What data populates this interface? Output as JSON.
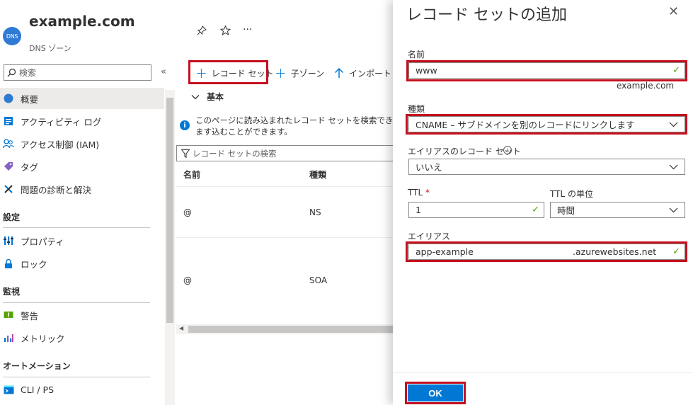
{
  "resource": {
    "badge": "DNS",
    "title": "example.com",
    "subtitle": "DNS ゾーン",
    "more": "···"
  },
  "search": {
    "placeholder": "検索",
    "collapse": "«"
  },
  "nav": {
    "items": [
      {
        "label": "概要",
        "icon": "dns-zone-icon"
      },
      {
        "label": "アクティビティ ログ",
        "icon": "activity-log-icon"
      },
      {
        "label": "アクセス制御 (IAM)",
        "icon": "iam-icon"
      },
      {
        "label": "タグ",
        "icon": "tag-icon"
      },
      {
        "label": "問題の診断と解決",
        "icon": "wrench-icon"
      },
      {
        "label": "プロパティ",
        "icon": "properties-icon"
      },
      {
        "label": "ロック",
        "icon": "lock-icon"
      },
      {
        "label": "警告",
        "icon": "alert-icon"
      },
      {
        "label": "メトリック",
        "icon": "metrics-icon"
      },
      {
        "label": "CLI / PS",
        "icon": "cli-icon"
      }
    ],
    "sections": [
      "設定",
      "監視",
      "オートメーション"
    ]
  },
  "commands": {
    "add_recordset": "レコード セット",
    "child_zone": "子ゾーン",
    "import": "インポート"
  },
  "essentials": "基本",
  "info_text": "このページに読み込まれたレコード セットを検索できます込むことができます。",
  "filter": {
    "placeholder": "レコード セットの検索"
  },
  "table": {
    "headers": [
      "名前",
      "種類"
    ],
    "rows": [
      {
        "name": "@",
        "type": "NS"
      },
      {
        "name": "@",
        "type": "SOA"
      }
    ]
  },
  "panel": {
    "title": "レコード セットの追加",
    "close": "✕",
    "name_label": "名前",
    "name_value": "www",
    "name_suffix": "example.com",
    "type_label": "種類",
    "type_value": "CNAME – サブドメインを別のレコードにリンクします",
    "alias_label": "エイリアスのレコード セット",
    "alias_value": "いいえ",
    "ttl_label": "TTL",
    "ttl_required": "*",
    "ttl_value": "1",
    "ttl_unit_label": "TTL の単位",
    "ttl_unit_value": "時間",
    "alias_target_label": "エイリアス",
    "alias_target_prefix": "app-example",
    "alias_target_suffix": ".azurewebsites.net",
    "ok_label": "OK"
  },
  "colors": {
    "accent": "#0078d4",
    "highlight_box": "#c50f1f",
    "valid_check": "#57a300"
  }
}
